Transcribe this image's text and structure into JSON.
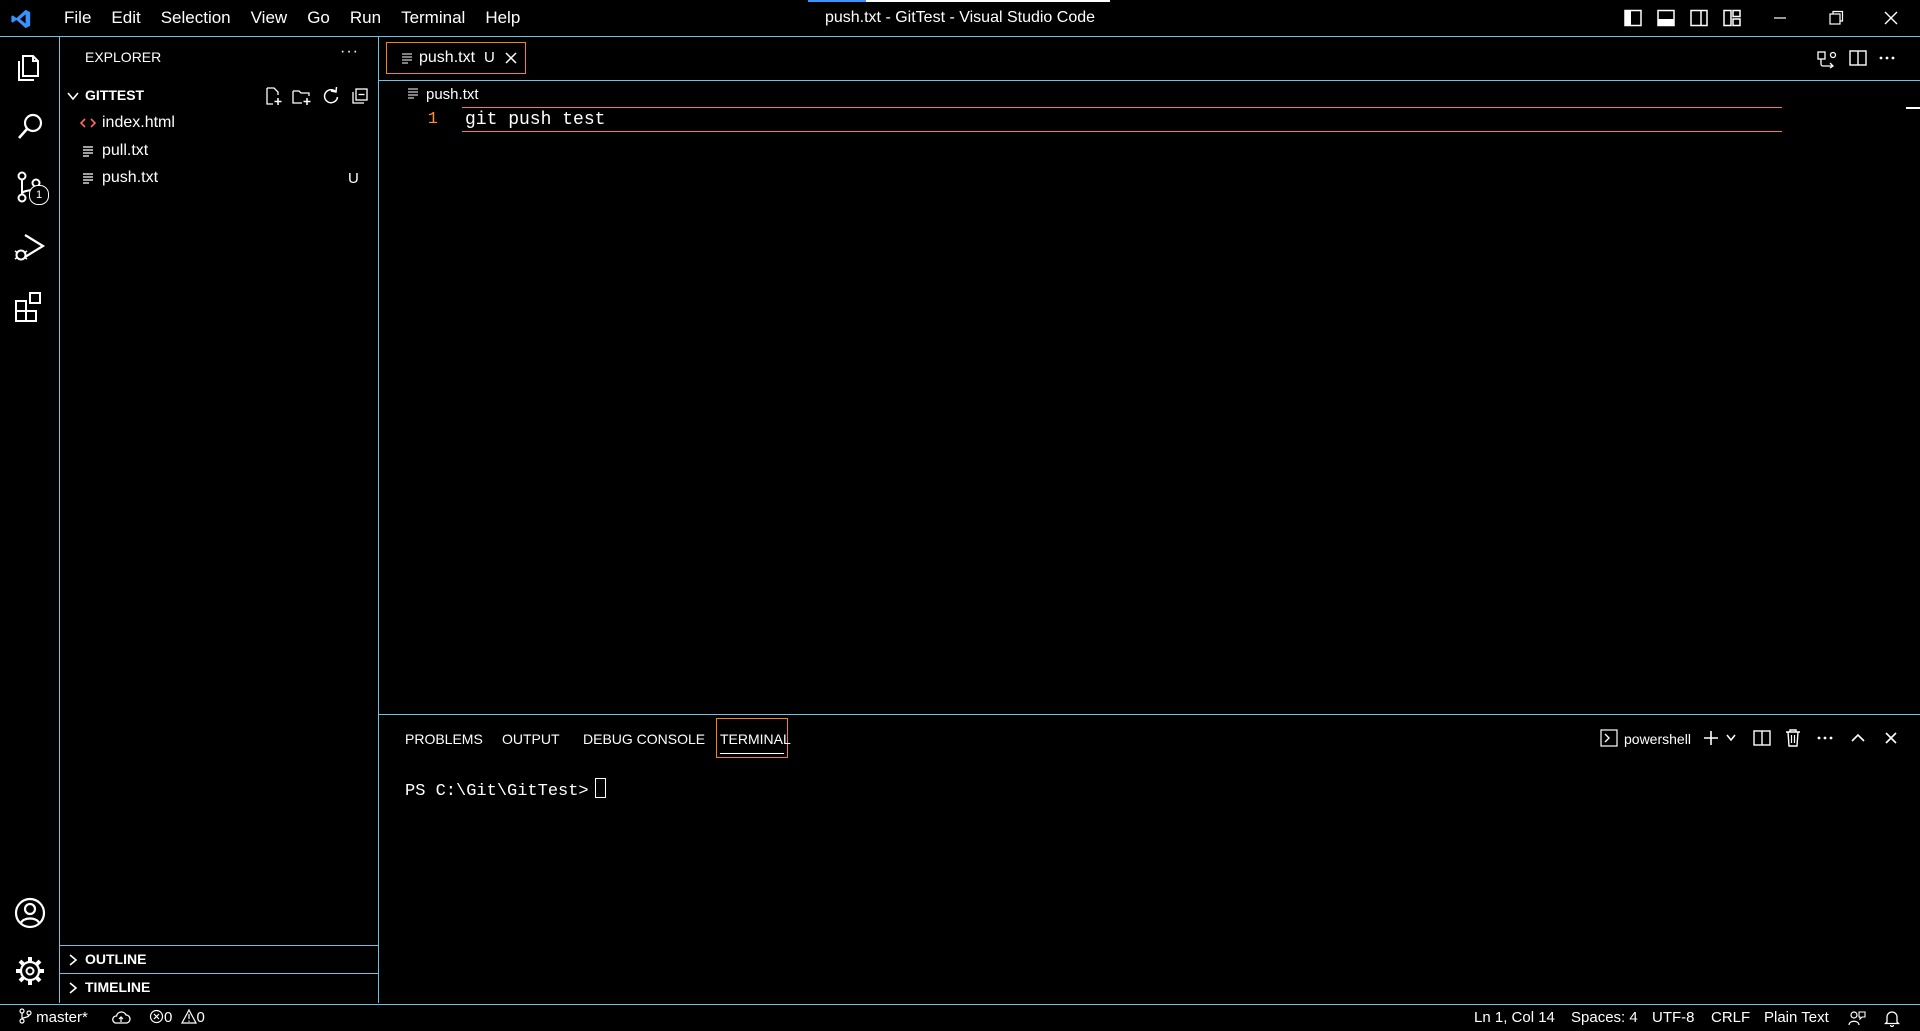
{
  "window": {
    "title": "push.txt - GitTest - Visual Studio Code",
    "menu": [
      "File",
      "Edit",
      "Selection",
      "View",
      "Go",
      "Run",
      "Terminal",
      "Help"
    ]
  },
  "activity_bar": {
    "source_control_badge": "1"
  },
  "explorer": {
    "title": "EXPLORER",
    "more": "···",
    "folder": "GITTEST",
    "files": [
      {
        "name": "index.html",
        "icon": "code-file-icon",
        "badge": ""
      },
      {
        "name": "pull.txt",
        "icon": "text-file-icon",
        "badge": ""
      },
      {
        "name": "push.txt",
        "icon": "text-file-icon",
        "badge": "U"
      }
    ],
    "sections": [
      "OUTLINE",
      "TIMELINE"
    ]
  },
  "editor": {
    "tab": {
      "label": "push.txt",
      "badge": "U"
    },
    "breadcrumb": "push.txt",
    "line_number": "1",
    "code": "git push test"
  },
  "panel": {
    "tabs": [
      "PROBLEMS",
      "OUTPUT",
      "DEBUG CONSOLE",
      "TERMINAL"
    ],
    "active_tab": "TERMINAL",
    "shell": "powershell",
    "prompt": "PS C:\\Git\\GitTest>"
  },
  "status_bar": {
    "branch": "master*",
    "errors": "0",
    "warnings": "0",
    "position": "Ln 1, Col 14",
    "spaces": "Spaces: 4",
    "encoding": "UTF-8",
    "eol": "CRLF",
    "language": "Plain Text"
  },
  "colors": {
    "background": "#000000",
    "border": "#6fc3df",
    "focus": "#f38518",
    "line_number": "#ff8c3a",
    "vscode_logo": "#3794ff"
  }
}
